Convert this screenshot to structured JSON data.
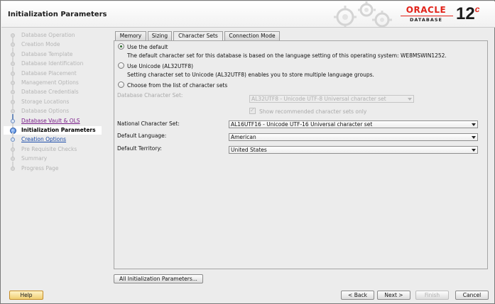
{
  "window": {
    "title": "Initialization Parameters"
  },
  "brand": {
    "oracle": "ORACLE",
    "database": "DATABASE",
    "version": "12",
    "version_suffix": "c",
    "accent": "#e2231a"
  },
  "nav": {
    "items": [
      {
        "label": "Database Operation",
        "state": "pending"
      },
      {
        "label": "Creation Mode",
        "state": "pending"
      },
      {
        "label": "Database Template",
        "state": "pending"
      },
      {
        "label": "Database Identification",
        "state": "pending"
      },
      {
        "label": "Database Placement",
        "state": "pending"
      },
      {
        "label": "Management Options",
        "state": "pending"
      },
      {
        "label": "Database Credentials",
        "state": "pending"
      },
      {
        "label": "Storage Locations",
        "state": "pending"
      },
      {
        "label": "Database Options",
        "state": "pending"
      },
      {
        "label": "Database Vault & OLS",
        "state": "done"
      },
      {
        "label": "Initialization Parameters",
        "state": "current"
      },
      {
        "label": "Creation Options",
        "state": "link"
      },
      {
        "label": "Pre Requisite Checks",
        "state": "pending"
      },
      {
        "label": "Summary",
        "state": "pending"
      },
      {
        "label": "Progress Page",
        "state": "pending"
      }
    ]
  },
  "tabs": [
    {
      "label": "Memory",
      "active": false
    },
    {
      "label": "Sizing",
      "active": false
    },
    {
      "label": "Character Sets",
      "active": true
    },
    {
      "label": "Connection Mode",
      "active": false
    }
  ],
  "charset": {
    "option_default": {
      "label": "Use the default",
      "selected": true,
      "desc": "The default character set for this database is based on the language setting of this operating system: WE8MSWIN1252."
    },
    "option_unicode": {
      "label": "Use Unicode (AL32UTF8)",
      "selected": false,
      "desc": "Setting character set to Unicode (AL32UTF8) enables you to store multiple language groups."
    },
    "option_list": {
      "label": "Choose from the list of character sets",
      "selected": false
    },
    "db_charset": {
      "label": "Database Character Set:",
      "value": "AL32UTF8 - Unicode UTF-8 Universal character set",
      "enabled": false
    },
    "show_recommended": {
      "label": "Show recommended character sets only",
      "checked": true,
      "enabled": false
    },
    "national": {
      "label": "National Character Set:",
      "value": "AL16UTF16 - Unicode UTF-16 Universal character set"
    },
    "language": {
      "label": "Default Language:",
      "value": "American"
    },
    "territory": {
      "label": "Default Territory:",
      "value": "United States"
    }
  },
  "buttons": {
    "all_params": "All Initialization Parameters...",
    "help": "Help",
    "back": "< Back",
    "next": "Next >",
    "finish": "Finish",
    "cancel": "Cancel"
  }
}
